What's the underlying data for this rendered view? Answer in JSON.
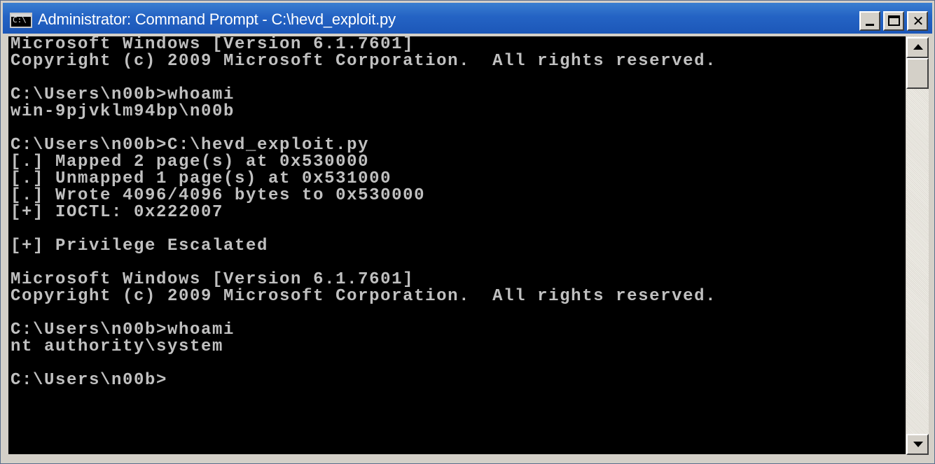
{
  "window": {
    "title": "Administrator: Command Prompt - C:\\hevd_exploit.py",
    "icon": "cmd-icon",
    "icon_text": "C:\\",
    "controls": {
      "minimize_icon": "minimize-icon",
      "maximize_icon": "maximize-icon",
      "close_icon": "close-icon",
      "close_glyph": "✕"
    }
  },
  "console": {
    "lines": [
      "Microsoft Windows [Version 6.1.7601]",
      "Copyright (c) 2009 Microsoft Corporation.  All rights reserved.",
      "",
      "C:\\Users\\n00b>whoami",
      "win-9pjvklm94bp\\n00b",
      "",
      "C:\\Users\\n00b>C:\\hevd_exploit.py",
      "[.] Mapped 2 page(s) at 0x530000",
      "[.] Unmapped 1 page(s) at 0x531000",
      "[.] Wrote 4096/4096 bytes to 0x530000",
      "[+] IOCTL: 0x222007",
      "",
      "[+] Privilege Escalated",
      "",
      "Microsoft Windows [Version 6.1.7601]",
      "Copyright (c) 2009 Microsoft Corporation.  All rights reserved.",
      "",
      "C:\\Users\\n00b>whoami",
      "nt authority\\system",
      "",
      "C:\\Users\\n00b>"
    ]
  },
  "scrollbar": {
    "up_icon": "scroll-up-arrow-icon",
    "down_icon": "scroll-down-arrow-icon"
  },
  "colors": {
    "titlebar": "#2463c4",
    "console_bg": "#000000",
    "console_text": "#c0c0c0"
  }
}
